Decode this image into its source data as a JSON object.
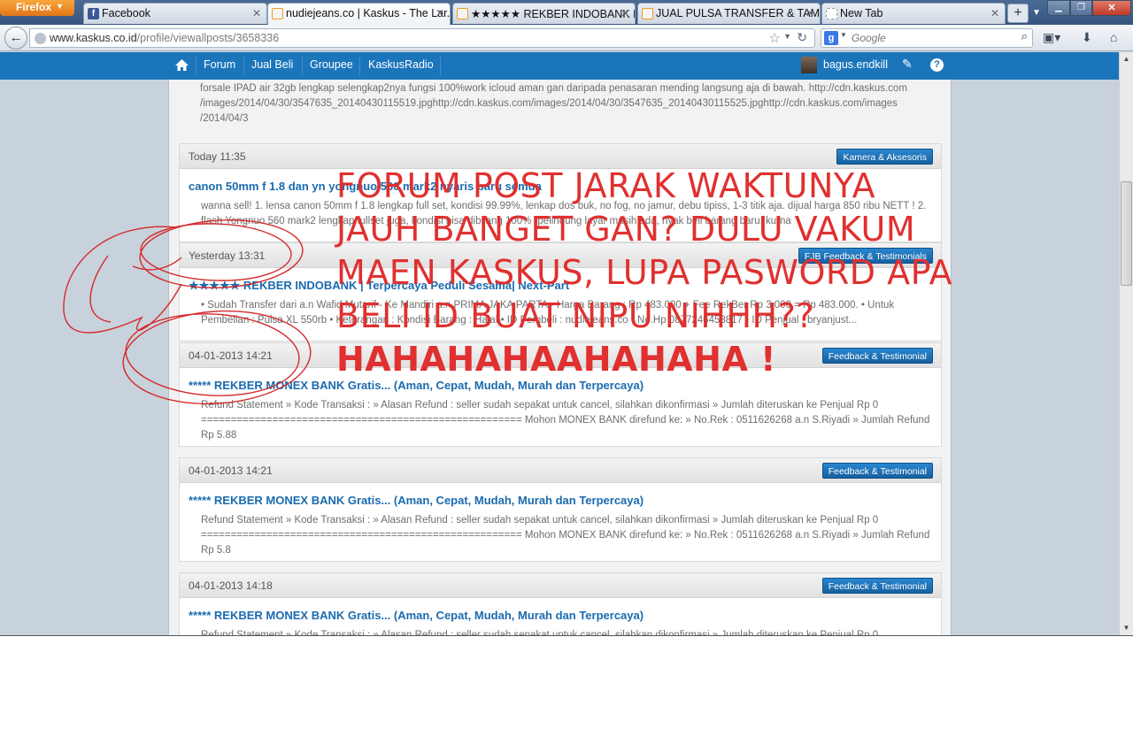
{
  "browser": {
    "app_button": "Firefox",
    "tabs": [
      {
        "label": "Facebook"
      },
      {
        "label": "nudiejeans.co | Kaskus - The Lar..."
      },
      {
        "label": "★★★★★ REKBER INDOBANK N..."
      },
      {
        "label": "JUAL PULSA TRANSFER & TAM..."
      },
      {
        "label": "New Tab"
      }
    ],
    "new_tab": "+",
    "url_host": "www.kaskus.co.id",
    "url_path": "/profile/viewallposts/3658336",
    "search_placeholder": "Google"
  },
  "kaskus": {
    "nav": [
      "Forum",
      "Jual Beli",
      "Groupee",
      "KaskusRadio"
    ],
    "username": "bagus.endkill",
    "help": "?"
  },
  "posts": {
    "first_body": "forsale IPAD air 32gb lengkap selengkap2nya fungsi 100%work icloud aman gan daripada penasaran mending langsung aja di bawah. http://cdn.kaskus.com /images/2014/04/30/3547635_20140430115519.jpghttp://cdn.kaskus.com/images/2014/04/30/3547635_20140430115525.jpghttp://cdn.kaskus.com/images /2014/04/3",
    "items": [
      {
        "date": "Today 11:35",
        "badge": "Kamera & Aksesoris",
        "title": "canon 50mm f 1.8 dan yn yongnuo 560 mark2 nyaris baru semua",
        "body": "wanna sell! 1. lensa canon 50mm f 1.8 lengkap full set, kondisi 99.99%, lenkap dos buk, no fog, no jamur, debu tipiss, 1-3 titik aja. dijual harga 850 ribu NETT ! 2. flash Yongnuo 560 mark2 lengkap fullset juga, kondisi bisa dibilang 100% (pelindung layar masih ada, nyak beli barang baru, kurna"
      },
      {
        "date": "Yesterday 13:31",
        "badge": "FJB Feedback & Testimonials",
        "title": "★★★★★ REKBER INDOBANK | Terpercaya Peduli Sesama| Next-Part",
        "body": "• Sudah Transfer dari a.n Wafid Mutarif - Ke Mandiri a.n PRIMA JAKA PARTA • Harga Barang : Rp 483.000 + Fee RekBer Rp 3.000 = Rp 483.000. • Untuk Pembelian : Pulsa XL 550rb • Keterangan : Kondisi Barang : Halal • ID Pembeli : nudiejeans.co • No.Hp 0877246458817 • ID Penjual : bryanjust..."
      },
      {
        "date": "04-01-2013 14:21",
        "badge": "Feedback & Testimonial",
        "title": "***** REKBER MONEX BANK Gratis... (Aman, Cepat, Mudah, Murah dan Terpercaya)",
        "body": "Refund Statement » Kode Transaksi : » Alasan Refund : seller sudah sepakat untuk cancel, silahkan dikonfirmasi » Jumlah diteruskan ke Penjual Rp 0 ====================================================== Mohon MONEX BANK direfund ke: » No.Rek : 0511626268 a.n S.Riyadi » Jumlah Refund Rp 5.88"
      },
      {
        "date": "04-01-2013 14:21",
        "badge": "Feedback & Testimonial",
        "title": "***** REKBER MONEX BANK Gratis... (Aman, Cepat, Mudah, Murah dan Terpercaya)",
        "body": "Refund Statement » Kode Transaksi : » Alasan Refund : seller sudah sepakat untuk cancel, silahkan dikonfirmasi » Jumlah diteruskan ke Penjual Rp 0 ====================================================== Mohon MONEX BANK direfund ke: » No.Rek : 0511626268 a.n S.Riyadi » Jumlah Refund Rp 5.8"
      },
      {
        "date": "04-01-2013 14:18",
        "badge": "Feedback & Testimonial",
        "title": "***** REKBER MONEX BANK Gratis... (Aman, Cepat, Mudah, Murah dan Terpercaya)",
        "body": "Refund Statement » Kode Transaksi : » Alasan Refund : seller sudah sepakat untuk cancel, silahkan dikonfirmasi » Jumlah diteruskan ke Penjual Rp 0"
      }
    ]
  },
  "annotation": {
    "lines": [
      "FORUM POST JARAK WAKTUNYA",
      "JAUH BANGET GAN? DULU VAKUM",
      "MAEN KASKUS, LUPA PASWORD APA",
      "BELI ID BUAT NIPU NIHHH??"
    ],
    "strong_line": "HAHAHAHAAHAHAHA !",
    "color": "#e0302f"
  },
  "colors": {
    "kaskus_blue": "#1b75bb",
    "title_blue": "#1a6bb0"
  }
}
